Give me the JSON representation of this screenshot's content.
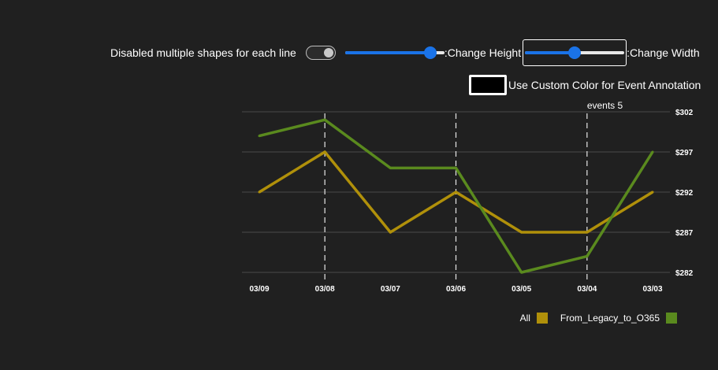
{
  "controls": {
    "toggle_label": "Disabled multiple shapes for each line",
    "height_label": ":Change Height",
    "width_label": ":Change Width",
    "height_value": 0.86,
    "width_value": 0.5,
    "custom_color_label": "Use Custom Color for Event Annotation",
    "custom_color": "#000000"
  },
  "chart_data": {
    "type": "line",
    "categories": [
      "03/09",
      "03/08",
      "03/07",
      "03/06",
      "03/05",
      "03/04",
      "03/03"
    ],
    "series": [
      {
        "name": "All",
        "color": "#b0900a",
        "values": [
          292,
          297,
          287,
          292,
          287,
          287,
          292
        ]
      },
      {
        "name": "From_Legacy_to_O365",
        "color": "#5a8a1e",
        "values": [
          299,
          301,
          295,
          295,
          282,
          284,
          297
        ]
      }
    ],
    "ylim": [
      282,
      302
    ],
    "yticks": [
      "$302",
      "$297",
      "$292",
      "$287",
      "$282"
    ],
    "ytick_values": [
      302,
      297,
      292,
      287,
      282
    ],
    "events": [
      {
        "category": "03/08"
      },
      {
        "category": "03/06"
      },
      {
        "category": "03/04",
        "label": "events 5"
      }
    ],
    "grid": true,
    "legend": "bottom-right"
  }
}
